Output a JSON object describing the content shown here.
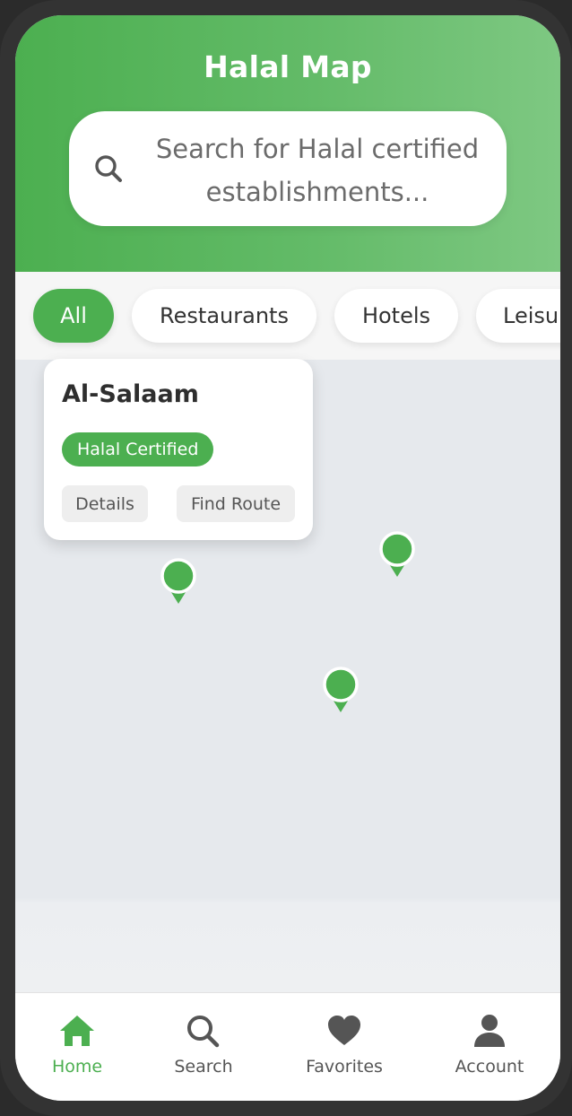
{
  "header": {
    "title": "Halal Map",
    "search": {
      "placeholder": "Search for Halal certified establishments...",
      "icon": "search-icon"
    }
  },
  "filters": {
    "chips": [
      "All",
      "Restaurants",
      "Hotels",
      "Leisure"
    ],
    "active": "All"
  },
  "info_card": {
    "name": "Al-Salaam",
    "badge": "Halal Certified",
    "details_label": "Details",
    "route_label": "Find Route"
  },
  "map": {
    "pin_icon": "map-pin-icon",
    "pin_count": 3
  },
  "bottom_nav": {
    "items": [
      {
        "label": "Home",
        "icon": "home-icon",
        "active": true
      },
      {
        "label": "Search",
        "icon": "search-icon",
        "active": false
      },
      {
        "label": "Favorites",
        "icon": "heart-icon",
        "active": false
      },
      {
        "label": "Account",
        "icon": "user-icon",
        "active": false
      }
    ]
  },
  "colors": {
    "primary": "#4caf50",
    "header_gradient_end": "#7ec882",
    "map_background": "#e6e9ed",
    "text_dark": "#2e2e2e",
    "text_muted": "#555555"
  }
}
